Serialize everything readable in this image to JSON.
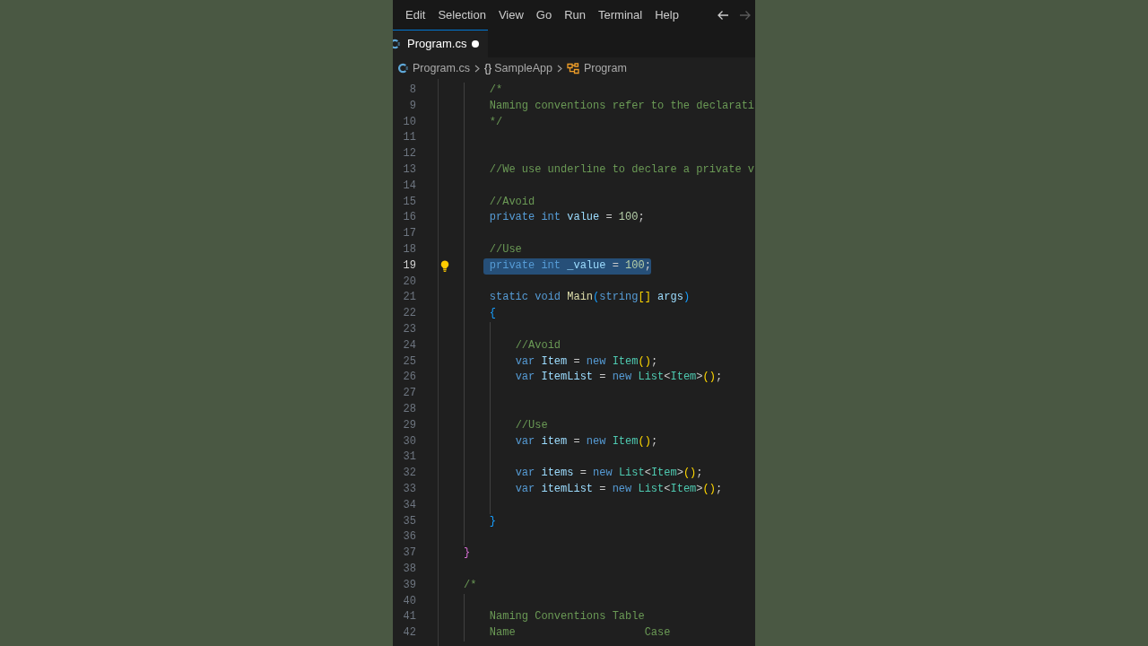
{
  "menu": [
    "Edit",
    "Selection",
    "View",
    "Go",
    "Run",
    "Terminal",
    "Help"
  ],
  "navigation": [
    {
      "kind": "back",
      "disabled": false
    },
    {
      "kind": "forward",
      "disabled": true
    }
  ],
  "tabs": [
    {
      "label": "Program.cs",
      "selected": true,
      "modified": true
    }
  ],
  "breadcrumbs": [
    {
      "kind": "file",
      "label": "Program.cs"
    },
    {
      "kind": "namespace",
      "icon": "{}",
      "label": "SampleApp"
    },
    {
      "kind": "class",
      "label": "Program"
    }
  ],
  "editor": {
    "lines": [
      {
        "number": "8",
        "selected": false,
        "lightbulb": false,
        "tokens": [
          {
            "kind": "comment",
            "text": "    /*"
          }
        ]
      },
      {
        "number": "9",
        "selected": false,
        "lightbulb": false,
        "tokens": [
          {
            "kind": "comment",
            "text": "    Naming conventions refer to the declarati"
          }
        ]
      },
      {
        "number": "10",
        "selected": false,
        "lightbulb": false,
        "tokens": [
          {
            "kind": "comment",
            "text": "    */"
          }
        ]
      },
      {
        "number": "11",
        "selected": false,
        "lightbulb": false
      },
      {
        "number": "12",
        "selected": false,
        "lightbulb": false
      },
      {
        "number": "13",
        "selected": false,
        "lightbulb": false,
        "tokens": [
          {
            "kind": "comment",
            "text": "    //We use underline to declare a private v"
          }
        ]
      },
      {
        "number": "14",
        "selected": false,
        "lightbulb": false
      },
      {
        "number": "15",
        "selected": false,
        "lightbulb": false,
        "tokens": [
          {
            "kind": "comment",
            "text": "    //Avoid"
          }
        ]
      },
      {
        "number": "16",
        "selected": false,
        "lightbulb": false,
        "tokens": [
          {
            "kind": "keyword",
            "text": "    private "
          },
          {
            "kind": "keyword",
            "text": "int "
          },
          {
            "kind": "variable",
            "text": "value"
          },
          {
            "kind": "punctuation",
            "text": " = "
          },
          {
            "kind": "number",
            "text": "100"
          },
          {
            "kind": "punctuation",
            "text": ";"
          }
        ]
      },
      {
        "number": "17",
        "selected": false,
        "lightbulb": false
      },
      {
        "number": "18",
        "selected": false,
        "lightbulb": false,
        "tokens": [
          {
            "kind": "comment",
            "text": "    //Use"
          }
        ]
      },
      {
        "number": "19",
        "selected": true,
        "lightbulb": true,
        "tokens": [
          {
            "kind": "keyword",
            "text": "    private "
          },
          {
            "kind": "keyword",
            "text": "int "
          },
          {
            "kind": "variable",
            "text": "_value"
          },
          {
            "kind": "punctuation",
            "text": " = "
          },
          {
            "kind": "number",
            "text": "100"
          },
          {
            "kind": "punctuation",
            "text": ";"
          }
        ]
      },
      {
        "number": "20",
        "selected": false,
        "lightbulb": false
      },
      {
        "number": "21",
        "selected": false,
        "lightbulb": false,
        "tokens": [
          {
            "kind": "keyword",
            "text": "    static "
          },
          {
            "kind": "keyword",
            "text": "void "
          },
          {
            "kind": "function",
            "text": "Main"
          },
          {
            "kind": "bracket3",
            "text": "("
          },
          {
            "kind": "keyword",
            "text": "string"
          },
          {
            "kind": "bracket1",
            "text": "[] "
          },
          {
            "kind": "variable",
            "text": "args"
          },
          {
            "kind": "bracket3",
            "text": ")"
          }
        ]
      },
      {
        "number": "22",
        "selected": false,
        "lightbulb": false,
        "tokens": [
          {
            "kind": "bracket3",
            "text": "    {"
          }
        ]
      },
      {
        "number": "23",
        "selected": false,
        "lightbulb": false
      },
      {
        "number": "24",
        "selected": false,
        "lightbulb": false,
        "tokens": [
          {
            "kind": "comment",
            "text": "        //Avoid"
          }
        ]
      },
      {
        "number": "25",
        "selected": false,
        "lightbulb": false,
        "tokens": [
          {
            "kind": "keyword",
            "text": "        var "
          },
          {
            "kind": "variable",
            "text": "Item"
          },
          {
            "kind": "punctuation",
            "text": " = "
          },
          {
            "kind": "keyword",
            "text": "new "
          },
          {
            "kind": "type",
            "text": "Item"
          },
          {
            "kind": "bracket1",
            "text": "()"
          },
          {
            "kind": "punctuation",
            "text": ";"
          }
        ]
      },
      {
        "number": "26",
        "selected": false,
        "lightbulb": false,
        "tokens": [
          {
            "kind": "keyword",
            "text": "        var "
          },
          {
            "kind": "variable",
            "text": "ItemList"
          },
          {
            "kind": "punctuation",
            "text": " = "
          },
          {
            "kind": "keyword",
            "text": "new "
          },
          {
            "kind": "type",
            "text": "List"
          },
          {
            "kind": "punctuation",
            "text": "<"
          },
          {
            "kind": "type",
            "text": "Item"
          },
          {
            "kind": "punctuation",
            "text": ">"
          },
          {
            "kind": "bracket1",
            "text": "()"
          },
          {
            "kind": "punctuation",
            "text": ";"
          }
        ]
      },
      {
        "number": "27",
        "selected": false,
        "lightbulb": false
      },
      {
        "number": "28",
        "selected": false,
        "lightbulb": false
      },
      {
        "number": "29",
        "selected": false,
        "lightbulb": false,
        "tokens": [
          {
            "kind": "comment",
            "text": "        //Use"
          }
        ]
      },
      {
        "number": "30",
        "selected": false,
        "lightbulb": false,
        "tokens": [
          {
            "kind": "keyword",
            "text": "        var "
          },
          {
            "kind": "variable",
            "text": "item"
          },
          {
            "kind": "punctuation",
            "text": " = "
          },
          {
            "kind": "keyword",
            "text": "new "
          },
          {
            "kind": "type",
            "text": "Item"
          },
          {
            "kind": "bracket1",
            "text": "()"
          },
          {
            "kind": "punctuation",
            "text": ";"
          }
        ]
      },
      {
        "number": "31",
        "selected": false,
        "lightbulb": false
      },
      {
        "number": "32",
        "selected": false,
        "lightbulb": false,
        "tokens": [
          {
            "kind": "keyword",
            "text": "        var "
          },
          {
            "kind": "variable",
            "text": "items"
          },
          {
            "kind": "punctuation",
            "text": " = "
          },
          {
            "kind": "keyword",
            "text": "new "
          },
          {
            "kind": "type",
            "text": "List"
          },
          {
            "kind": "punctuation",
            "text": "<"
          },
          {
            "kind": "type",
            "text": "Item"
          },
          {
            "kind": "punctuation",
            "text": ">"
          },
          {
            "kind": "bracket1",
            "text": "()"
          },
          {
            "kind": "punctuation",
            "text": ";"
          }
        ]
      },
      {
        "number": "33",
        "selected": false,
        "lightbulb": false,
        "tokens": [
          {
            "kind": "keyword",
            "text": "        var "
          },
          {
            "kind": "variable",
            "text": "itemList"
          },
          {
            "kind": "punctuation",
            "text": " = "
          },
          {
            "kind": "keyword",
            "text": "new "
          },
          {
            "kind": "type",
            "text": "List"
          },
          {
            "kind": "punctuation",
            "text": "<"
          },
          {
            "kind": "type",
            "text": "Item"
          },
          {
            "kind": "punctuation",
            "text": ">"
          },
          {
            "kind": "bracket1",
            "text": "()"
          },
          {
            "kind": "punctuation",
            "text": ";"
          }
        ]
      },
      {
        "number": "34",
        "selected": false,
        "lightbulb": false
      },
      {
        "number": "35",
        "selected": false,
        "lightbulb": false,
        "tokens": [
          {
            "kind": "bracket3",
            "text": "    }"
          }
        ]
      },
      {
        "number": "36",
        "selected": false,
        "lightbulb": false
      },
      {
        "number": "37",
        "selected": false,
        "lightbulb": false,
        "tokens": [
          {
            "kind": "bracket2",
            "text": "}"
          }
        ]
      },
      {
        "number": "38",
        "selected": false,
        "lightbulb": false
      },
      {
        "number": "39",
        "selected": false,
        "lightbulb": false,
        "tokens": [
          {
            "kind": "comment",
            "text": "/*"
          }
        ]
      },
      {
        "number": "40",
        "selected": false,
        "lightbulb": false
      },
      {
        "number": "41",
        "selected": false,
        "lightbulb": false,
        "tokens": [
          {
            "kind": "comment",
            "text": "    Naming Conventions Table"
          }
        ]
      },
      {
        "number": "42",
        "selected": false,
        "lightbulb": false,
        "tokens": [
          {
            "kind": "comment",
            "text": "    Name                    Case"
          }
        ]
      }
    ]
  }
}
